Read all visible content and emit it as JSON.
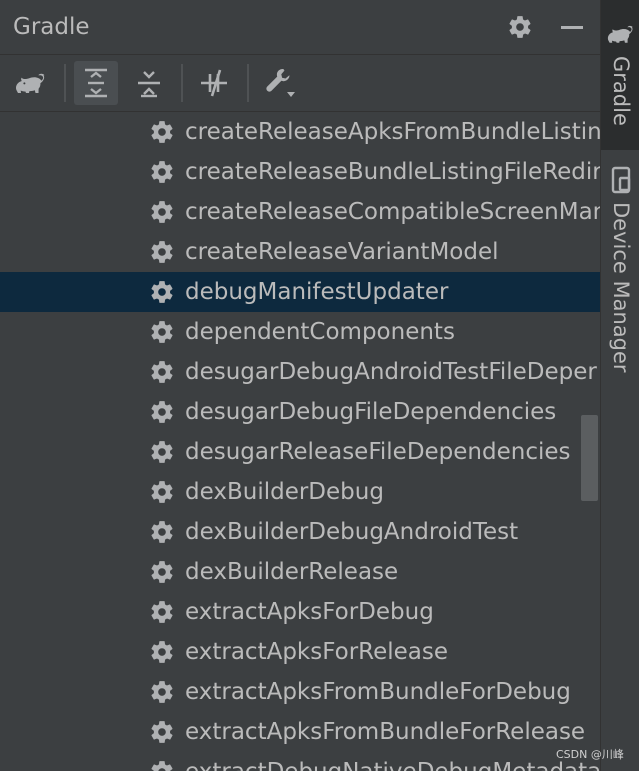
{
  "header": {
    "title": "Gradle",
    "gear_icon": "gear-icon",
    "minimize_icon": "minimize-icon"
  },
  "toolbar": {
    "buttons": [
      {
        "icon": "gradle-elephant-icon"
      },
      {
        "icon": "expand-all-icon",
        "active": true
      },
      {
        "icon": "collapse-all-icon"
      },
      {
        "icon": "toggle-offline-icon"
      },
      {
        "icon": "build-settings-wrench-icon"
      }
    ]
  },
  "tasks": [
    {
      "label": "createReleaseApksFromBundleListin"
    },
    {
      "label": "createReleaseBundleListingFileRedire"
    },
    {
      "label": "createReleaseCompatibleScreenMan"
    },
    {
      "label": "createReleaseVariantModel"
    },
    {
      "label": "debugManifestUpdater",
      "selected": true
    },
    {
      "label": "dependentComponents"
    },
    {
      "label": "desugarDebugAndroidTestFileDeper"
    },
    {
      "label": "desugarDebugFileDependencies"
    },
    {
      "label": "desugarReleaseFileDependencies"
    },
    {
      "label": "dexBuilderDebug"
    },
    {
      "label": "dexBuilderDebugAndroidTest"
    },
    {
      "label": "dexBuilderRelease"
    },
    {
      "label": "extractApksForDebug"
    },
    {
      "label": "extractApksForRelease"
    },
    {
      "label": "extractApksFromBundleForDebug"
    },
    {
      "label": "extractApksFromBundleForRelease"
    },
    {
      "label": "extractDebugNativeDebugMetadata"
    }
  ],
  "side_tabs": {
    "gradle": {
      "label": "Gradle",
      "icon": "gradle-elephant-icon"
    },
    "device_manager": {
      "label": "Device Manager",
      "icon": "device-icon"
    }
  },
  "watermark": "CSDN @川峰",
  "colors": {
    "background": "#3c3f41",
    "text": "#bbbbbb",
    "selection": "#0d293e",
    "icon": "#afb1b3"
  }
}
